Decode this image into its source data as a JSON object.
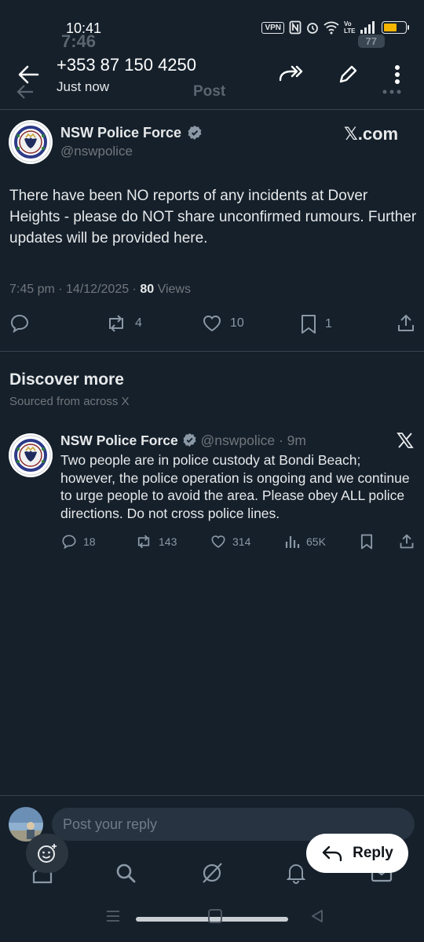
{
  "status_bar": {
    "time": "10:41",
    "ghost_time": "7:46",
    "vpn_label": "VPN",
    "lte_label": "Vo LTE",
    "ghost_battery": "77"
  },
  "header": {
    "title": "+353 87 150 4250",
    "subtitle": "Just now",
    "ghost_title": "Post"
  },
  "main_post": {
    "author_name": "NSW Police Force",
    "handle": "@nswpolice",
    "source_label": "𝕏.com",
    "text": "There have been NO reports of any incidents at Dover Heights - please do NOT share unconfirmed rumours. Further updates will be provided here.",
    "time": "7:45 pm · 14/12/2025 · ",
    "views_count": "80",
    "views_label": " Views",
    "reposts": "4",
    "likes": "10",
    "bookmarks": "1"
  },
  "discover": {
    "title": "Discover more",
    "subtitle": "Sourced from across X"
  },
  "card": {
    "author_name": "NSW Police Force",
    "handle_time": "@nswpolice · 9m",
    "text": "Two people are in police custody at Bondi Beach; however, the police operation is ongoing and we continue to urge people to avoid the area. Please obey ALL police directions.  Do not cross police lines.",
    "replies": "18",
    "reposts": "143",
    "likes": "314",
    "views": "65K"
  },
  "reply": {
    "placeholder": "Post your reply",
    "button_label": "Reply"
  },
  "colors": {
    "background": "#15202b",
    "text": "#e7e9ea",
    "muted": "#71767b",
    "verified": "#8b98a5",
    "battery": "#f5b400"
  }
}
